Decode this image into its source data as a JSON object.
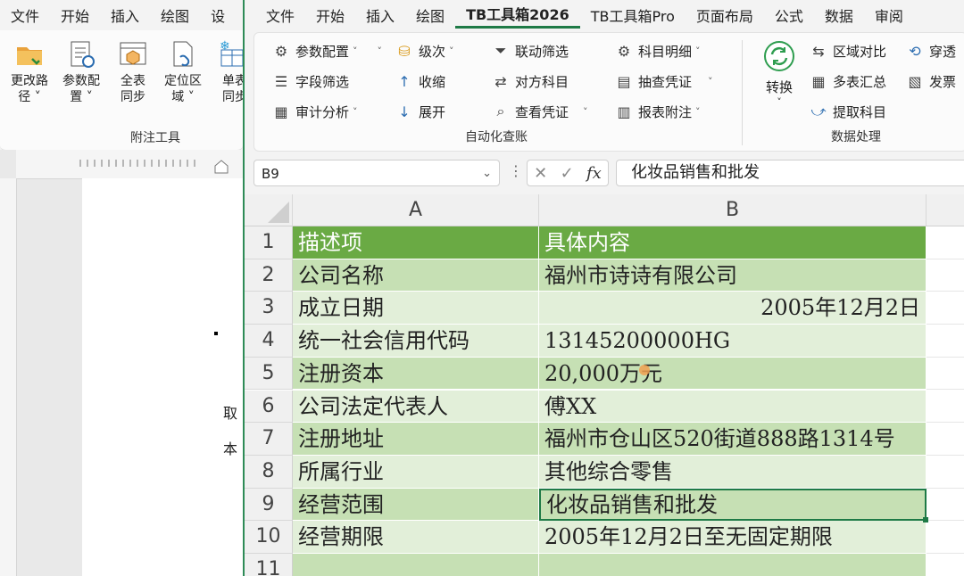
{
  "word": {
    "tabs": [
      "文件",
      "开始",
      "插入",
      "绘图",
      "设"
    ],
    "buttons": [
      {
        "line1": "更改路",
        "line2": "径 ˅"
      },
      {
        "line1": "参数配",
        "line2": "置 ˅"
      },
      {
        "line1": "全表",
        "line2": "同步"
      },
      {
        "line1": "定位区",
        "line2": "域 ˅"
      },
      {
        "line1": "单表",
        "line2": "同步"
      }
    ],
    "group_label": "附注工具",
    "doc_chars": [
      "取",
      "本"
    ]
  },
  "excel": {
    "tabs": [
      "文件",
      "开始",
      "插入",
      "绘图",
      "TB工具箱2026",
      "TB工具箱Pro",
      "页面布局",
      "公式",
      "数据",
      "审阅"
    ],
    "active_tab": "TB工具箱2026",
    "ribbon": {
      "col1": [
        "参数配置",
        "字段筛选",
        "审计分析"
      ],
      "col2": [
        "级次",
        "收缩",
        "展开"
      ],
      "col3": [
        "联动筛选",
        "对方科目",
        "查看凭证"
      ],
      "col4": [
        "科目明细",
        "抽查凭证",
        "报表附注"
      ],
      "group1_label": "自动化查账",
      "convert": "转换",
      "col5": [
        "区域对比",
        "多表汇总",
        "提取科目"
      ],
      "col6": [
        "穿透",
        "发票"
      ],
      "group2_label": "数据处理"
    },
    "name_box": "B9",
    "formula": "化妆品销售和批发",
    "columns": [
      "A",
      "B"
    ],
    "rows": [
      {
        "n": "1",
        "a": "描述项",
        "b": "具体内容"
      },
      {
        "n": "2",
        "a": "公司名称",
        "b": "福州市诗诗有限公司"
      },
      {
        "n": "3",
        "a": "成立日期",
        "b": "2005年12月2日"
      },
      {
        "n": "4",
        "a": "统一社会信用代码",
        "b": "13145200000HG"
      },
      {
        "n": "5",
        "a": "注册资本",
        "b": "20,000万元"
      },
      {
        "n": "6",
        "a": "公司法定代表人",
        "b": "傅XX"
      },
      {
        "n": "7",
        "a": "注册地址",
        "b": "福州市仓山区520街道888路1314号"
      },
      {
        "n": "8",
        "a": "所属行业",
        "b": "其他综合零售"
      },
      {
        "n": "9",
        "a": "经营范围",
        "b": "化妆品销售和批发"
      },
      {
        "n": "10",
        "a": "经营期限",
        "b": "2005年12月2日至无固定期限"
      },
      {
        "n": "11",
        "a": "",
        "b": ""
      }
    ]
  },
  "colors": {
    "header_green": "#6aaa44",
    "dark_band": "#c6e0b4",
    "light_band": "#e2efd9",
    "accent": "#1e7a46"
  }
}
